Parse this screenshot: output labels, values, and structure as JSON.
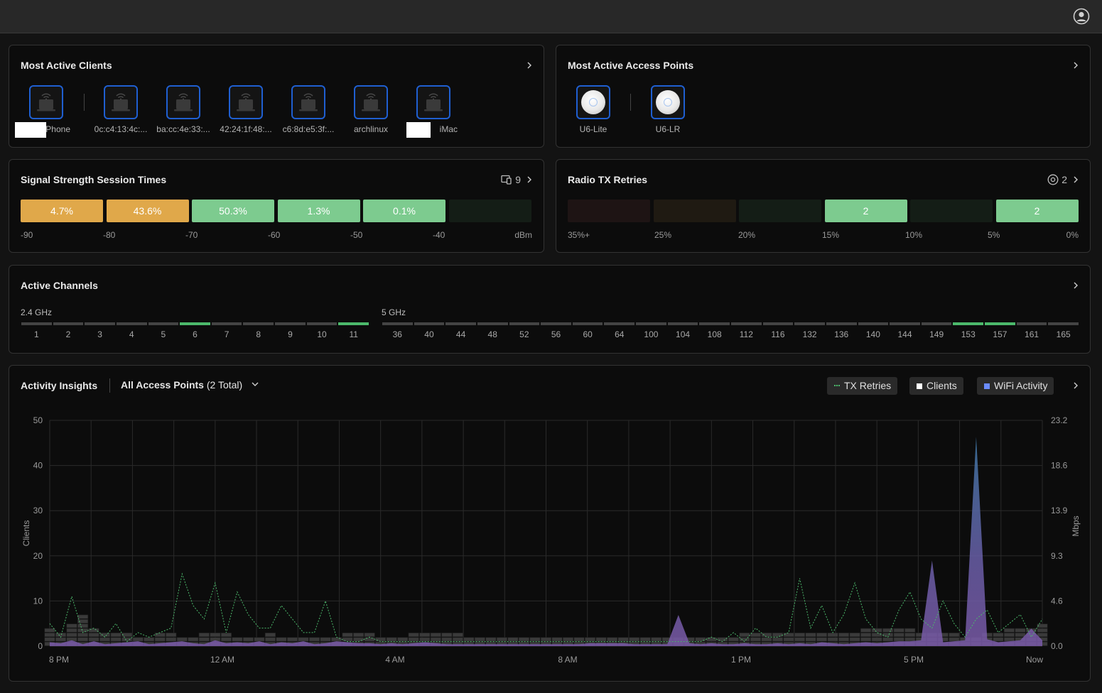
{
  "header": {
    "avatar_icon": "user-circle-icon"
  },
  "most_active_clients": {
    "title": "Most Active Clients",
    "clients": [
      {
        "label": "iPhone",
        "redacted": true
      },
      {
        "label": "0c:c4:13:4c:..."
      },
      {
        "label": "ba:cc:4e:33:..."
      },
      {
        "label": "42:24:1f:48:..."
      },
      {
        "label": "c6:8d:e5:3f:..."
      },
      {
        "label": "archlinux"
      },
      {
        "label": "iMac",
        "redacted": true
      }
    ]
  },
  "most_active_aps": {
    "title": "Most Active Access Points",
    "aps": [
      {
        "label": "U6-Lite"
      },
      {
        "label": "U6-LR"
      }
    ]
  },
  "signal_strength": {
    "title": "Signal Strength Session Times",
    "count": "9",
    "segments": [
      {
        "label": "4.7%",
        "color": "#e0a84a"
      },
      {
        "label": "43.6%",
        "color": "#e0a84a"
      },
      {
        "label": "50.3%",
        "color": "#7dcb8f"
      },
      {
        "label": "1.3%",
        "color": "#7dcb8f"
      },
      {
        "label": "0.1%",
        "color": "#7dcb8f"
      },
      {
        "label": "",
        "color": "#141d16"
      }
    ],
    "ticks": [
      "-90",
      "-80",
      "-70",
      "-60",
      "-50",
      "-40",
      "dBm"
    ]
  },
  "radio_tx_retries": {
    "title": "Radio TX Retries",
    "count": "2",
    "segments": [
      {
        "label": "",
        "color": "#1e1414"
      },
      {
        "label": "",
        "color": "#1f1a12"
      },
      {
        "label": "",
        "color": "#141d16"
      },
      {
        "label": "2",
        "color": "#7dcb8f"
      },
      {
        "label": "",
        "color": "#141d16"
      },
      {
        "label": "2",
        "color": "#7dcb8f"
      }
    ],
    "ticks": [
      "35%+",
      "25%",
      "20%",
      "15%",
      "10%",
      "5%",
      "0%"
    ]
  },
  "active_channels": {
    "title": "Active Channels",
    "band24": {
      "label": "2.4 GHz",
      "channels": [
        "1",
        "2",
        "3",
        "4",
        "5",
        "6",
        "7",
        "8",
        "9",
        "10",
        "11"
      ],
      "active": [
        "6",
        "11"
      ]
    },
    "band5": {
      "label": "5 GHz",
      "channels": [
        "36",
        "40",
        "44",
        "48",
        "52",
        "56",
        "60",
        "64",
        "100",
        "104",
        "108",
        "112",
        "116",
        "132",
        "136",
        "140",
        "144",
        "149",
        "153",
        "157",
        "161",
        "165"
      ],
      "active": [
        "153",
        "157"
      ]
    }
  },
  "activity_insights": {
    "title": "Activity Insights",
    "filter_bold": "All Access Points",
    "filter_rest": "(2 Total)",
    "legend": [
      {
        "label": "TX Retries",
        "color": "#4cb96b"
      },
      {
        "label": "Clients",
        "color": "#ffffff"
      },
      {
        "label": "WiFi Activity",
        "color": "#6b8cff"
      }
    ],
    "chart_data": {
      "type": "area",
      "ylabel_left": "Clients",
      "ylabel_right": "Mbps",
      "y_left_ticks": [
        "50",
        "40",
        "30",
        "20",
        "10",
        "0"
      ],
      "y_right_ticks": [
        "23.2",
        "18.6",
        "13.9",
        "9.3",
        "4.6",
        "0.0"
      ],
      "y_left_range": [
        0,
        50
      ],
      "y_right_range": [
        0,
        23.2
      ],
      "x_ticks": [
        "8 PM",
        "12 AM",
        "4 AM",
        "8 AM",
        "1 PM",
        "5 PM",
        "Now"
      ],
      "grid": true,
      "series": [
        {
          "name": "Clients",
          "values": [
            4,
            3,
            5,
            7,
            4,
            3,
            3,
            3,
            2,
            2,
            3,
            3,
            2,
            2,
            3,
            3,
            3,
            2,
            2,
            2,
            3,
            2,
            2,
            2,
            2,
            2,
            2,
            3,
            3,
            3,
            2,
            2,
            2,
            3,
            3,
            3,
            3,
            3,
            2,
            2,
            2,
            2,
            2,
            2,
            2,
            2,
            2,
            2,
            2,
            2,
            2,
            2,
            2,
            2,
            2,
            2,
            2,
            2,
            2,
            2,
            2,
            2,
            2,
            3,
            3,
            3,
            3,
            3,
            3,
            3,
            3,
            3,
            3,
            3,
            4,
            4,
            4,
            4,
            4,
            3,
            3,
            3,
            3,
            2,
            2,
            3,
            3,
            4,
            4,
            4,
            5
          ]
        },
        {
          "name": "TX Retries",
          "values": [
            5,
            2,
            11,
            3,
            4,
            2,
            5,
            1,
            3,
            2,
            3,
            4,
            16,
            9,
            6,
            14,
            3,
            12,
            7,
            4,
            4,
            9,
            6,
            3,
            3,
            10,
            2,
            1,
            1,
            2,
            1,
            1,
            1,
            1,
            1,
            1,
            1,
            1,
            1,
            1,
            1,
            1,
            1,
            1,
            1,
            1,
            1,
            1,
            1,
            1,
            1,
            1,
            1,
            1,
            1,
            1,
            1,
            1,
            1,
            1,
            2,
            1,
            3,
            1,
            4,
            2,
            2,
            3,
            15,
            4,
            9,
            3,
            7,
            14,
            6,
            3,
            2,
            8,
            12,
            6,
            4,
            10,
            5,
            2,
            6,
            8,
            3,
            5,
            7,
            2,
            6
          ]
        },
        {
          "name": "WiFi Activity",
          "values": [
            0.4,
            0.3,
            0.6,
            0.2,
            0.5,
            0.2,
            0.3,
            0.4,
            0.5,
            0.2,
            0.3,
            0.4,
            0.5,
            0.3,
            0.2,
            0.6,
            0.3,
            0.4,
            0.3,
            0.5,
            0.2,
            0.4,
            0.3,
            0.5,
            0.2,
            0.3,
            0.5,
            0.4,
            0.3,
            0.3,
            0.2,
            0.3,
            0.2,
            0.3,
            0.4,
            0.3,
            0.2,
            0.2,
            0.2,
            0.2,
            0.2,
            0.2,
            0.2,
            0.2,
            0.2,
            0.2,
            0.2,
            0.2,
            0.2,
            0.3,
            0.3,
            0.3,
            0.3,
            0.2,
            0.2,
            0.2,
            0.2,
            3.2,
            0.3,
            0.2,
            0.3,
            0.2,
            0.2,
            0.3,
            0.2,
            0.2,
            0.3,
            0.2,
            0.3,
            0.2,
            0.4,
            0.3,
            0.2,
            0.3,
            0.4,
            0.3,
            0.4,
            0.5,
            0.5,
            0.6,
            8.8,
            0.4,
            0.5,
            0.6,
            21.5,
            0.7,
            0.4,
            0.5,
            0.6,
            1.8,
            0.6
          ]
        }
      ]
    }
  }
}
